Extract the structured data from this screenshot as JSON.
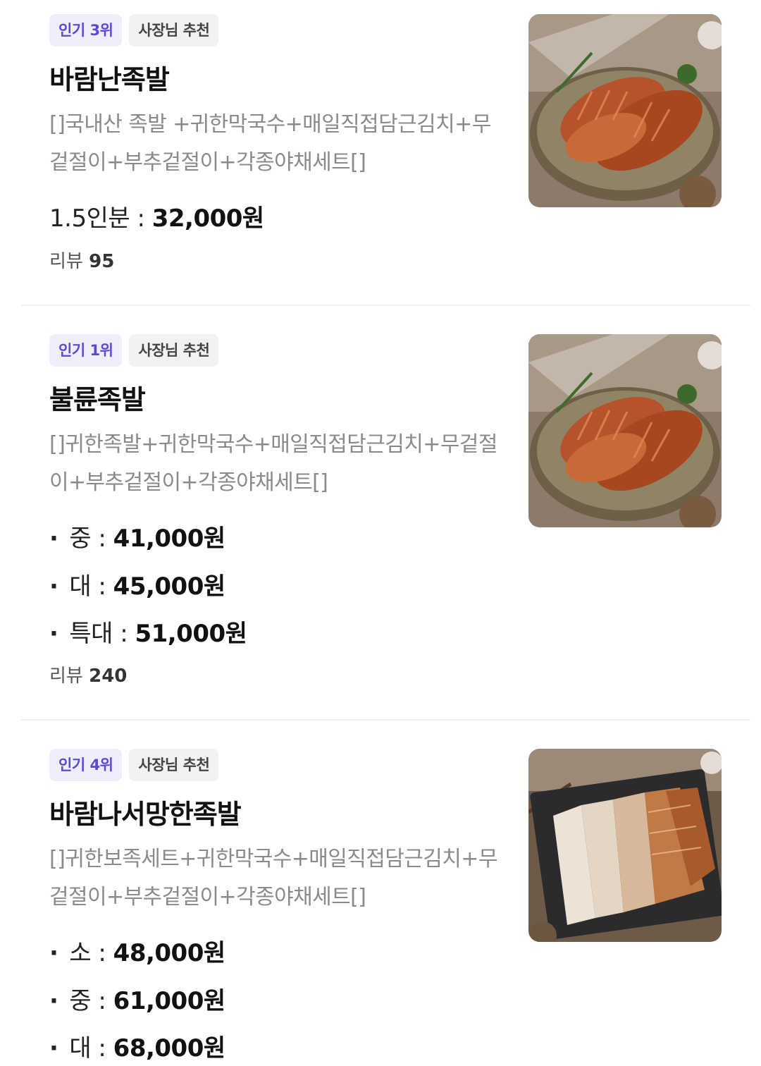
{
  "items": [
    {
      "rank_badge": "인기 3위",
      "owner_badge": "사장님 추천",
      "name": "바람난족발",
      "description": "[]국내산 족발 +귀한막국수+매일직접담근김치+무겉절이+부추겉절이+각종야채세트[]",
      "prices": [
        {
          "label": "1.5인분",
          "amount": "32,000원"
        }
      ],
      "review_label": "리뷰",
      "review_count": "95",
      "image_icon": "jokbal-plate-photo"
    },
    {
      "rank_badge": "인기 1위",
      "owner_badge": "사장님 추천",
      "name": "불륜족발",
      "description": "[]귀한족발+귀한막국수+매일직접담근김치+무겉절이+부추겉절이+각종야채세트[]",
      "prices": [
        {
          "label": "중",
          "amount": "41,000원"
        },
        {
          "label": "대",
          "amount": "45,000원"
        },
        {
          "label": "특대",
          "amount": "51,000원"
        }
      ],
      "review_label": "리뷰",
      "review_count": "240",
      "image_icon": "jokbal-plate-photo"
    },
    {
      "rank_badge": "인기 4위",
      "owner_badge": "사장님 추천",
      "name": "바람나서망한족발",
      "description": "[]귀한보족세트+귀한막국수+매일직접담근김치+무겉절이+부추겉절이+각종야채세트[]",
      "prices": [
        {
          "label": "소",
          "amount": "48,000원"
        },
        {
          "label": "중",
          "amount": "61,000원"
        },
        {
          "label": "대",
          "amount": "68,000원"
        }
      ],
      "image_icon": "bossam-jokbal-board-photo"
    }
  ],
  "colors": {
    "rank_badge_bg": "#f1eefc",
    "rank_badge_text": "#5a4bd6",
    "owner_badge_bg": "#f2f2f4",
    "description_text": "#8a8a8a"
  }
}
